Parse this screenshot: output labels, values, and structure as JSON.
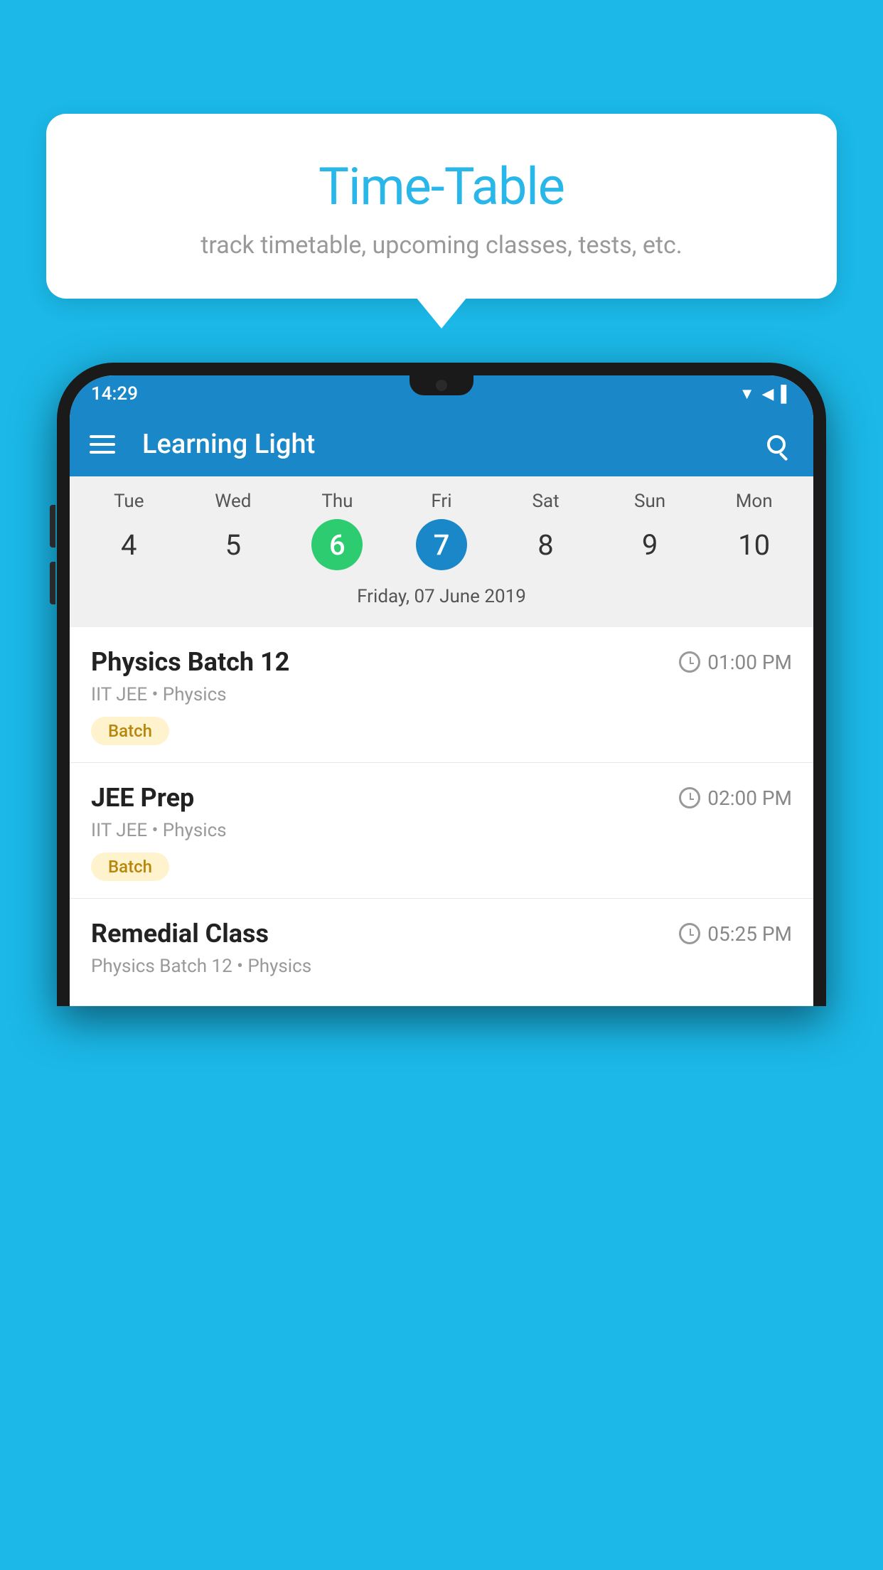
{
  "background": {
    "color": "#1BB8E8"
  },
  "tooltip": {
    "title": "Time-Table",
    "subtitle": "track timetable, upcoming classes, tests, etc."
  },
  "phone": {
    "status_bar": {
      "time": "14:29",
      "icons": "▼◀▌"
    },
    "app_bar": {
      "title": "Learning Light",
      "search_label": "search"
    },
    "calendar": {
      "days": [
        {
          "name": "Tue",
          "num": "4",
          "state": "normal"
        },
        {
          "name": "Wed",
          "num": "5",
          "state": "normal"
        },
        {
          "name": "Thu",
          "num": "6",
          "state": "today"
        },
        {
          "name": "Fri",
          "num": "7",
          "state": "selected"
        },
        {
          "name": "Sat",
          "num": "8",
          "state": "normal"
        },
        {
          "name": "Sun",
          "num": "9",
          "state": "normal"
        },
        {
          "name": "Mon",
          "num": "10",
          "state": "normal"
        }
      ],
      "selected_date_label": "Friday, 07 June 2019"
    },
    "classes": [
      {
        "name": "Physics Batch 12",
        "time": "01:00 PM",
        "meta": "IIT JEE • Physics",
        "tag": "Batch"
      },
      {
        "name": "JEE Prep",
        "time": "02:00 PM",
        "meta": "IIT JEE • Physics",
        "tag": "Batch"
      },
      {
        "name": "Remedial Class",
        "time": "05:25 PM",
        "meta": "Physics Batch 12 • Physics",
        "tag": ""
      }
    ]
  }
}
